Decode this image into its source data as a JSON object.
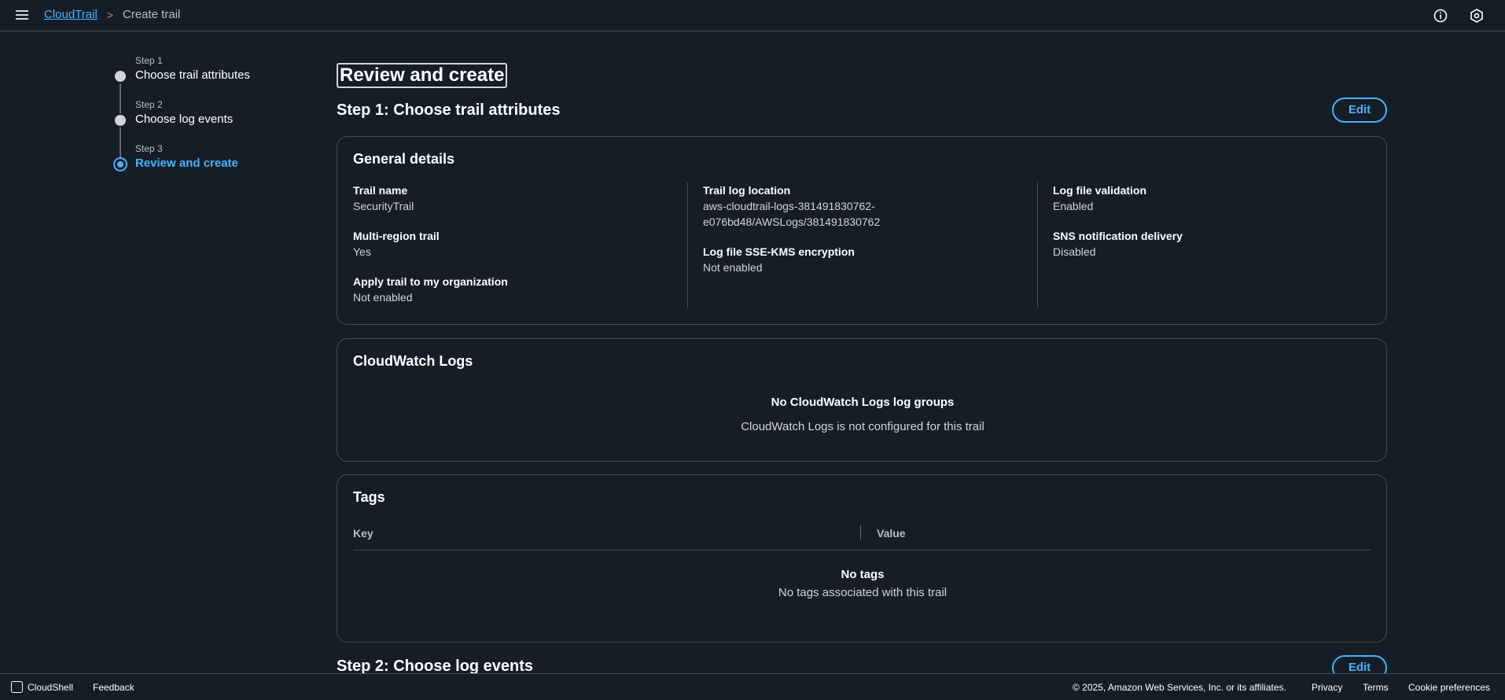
{
  "header": {
    "breadcrumb_root": "CloudTrail",
    "breadcrumb_current": "Create trail"
  },
  "steps": [
    {
      "num": "Step 1",
      "title": "Choose trail attributes"
    },
    {
      "num": "Step 2",
      "title": "Choose log events"
    },
    {
      "num": "Step 3",
      "title": "Review and create"
    }
  ],
  "main": {
    "page_title": "Review and create",
    "step1_heading": "Step 1: Choose trail attributes",
    "step2_heading": "Step 2: Choose log events",
    "edit_label": "Edit"
  },
  "general": {
    "title": "General details",
    "trail_name_k": "Trail name",
    "trail_name_v": "SecurityTrail",
    "multi_region_k": "Multi-region trail",
    "multi_region_v": "Yes",
    "apply_org_k": "Apply trail to my organization",
    "apply_org_v": "Not enabled",
    "log_location_k": "Trail log location",
    "log_location_v1": "aws-cloudtrail-logs-381491830762-",
    "log_location_v2": "e076bd48/AWSLogs/381491830762",
    "sse_kms_k": "Log file SSE-KMS encryption",
    "sse_kms_v": "Not enabled",
    "validation_k": "Log file validation",
    "validation_v": "Enabled",
    "sns_k": "SNS notification delivery",
    "sns_v": "Disabled"
  },
  "cloudwatch": {
    "title": "CloudWatch Logs",
    "empty_title": "No CloudWatch Logs log groups",
    "empty_sub": "CloudWatch Logs is not configured for this trail"
  },
  "tags": {
    "title": "Tags",
    "col_key": "Key",
    "col_value": "Value",
    "empty_title": "No tags",
    "empty_sub": "No tags associated with this trail"
  },
  "footer": {
    "cloudshell": "CloudShell",
    "feedback": "Feedback",
    "copyright": "© 2025, Amazon Web Services, Inc. or its affiliates.",
    "privacy": "Privacy",
    "terms": "Terms",
    "cookie": "Cookie preferences"
  },
  "colors": {
    "background": "#161d26",
    "accent": "#42b4ff",
    "border": "#414d5c"
  }
}
